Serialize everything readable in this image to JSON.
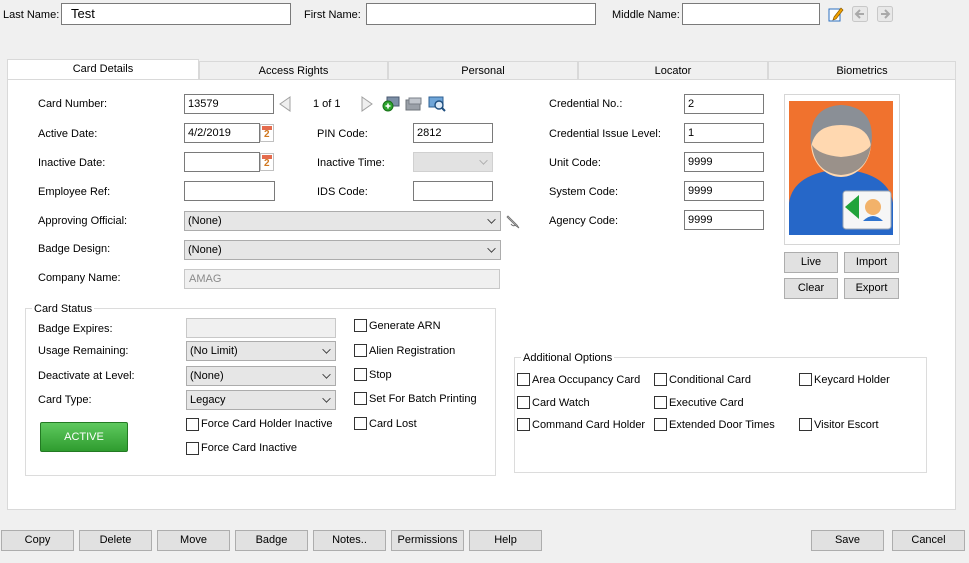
{
  "header": {
    "last_name_label": "Last Name:",
    "last_name_value": "Test",
    "first_name_label": "First Name:",
    "first_name_value": "",
    "middle_name_label": "Middle Name:",
    "middle_name_value": ""
  },
  "tabs": [
    {
      "label": "Card Details"
    },
    {
      "label": "Access Rights"
    },
    {
      "label": "Personal"
    },
    {
      "label": "Locator"
    },
    {
      "label": "Biometrics"
    }
  ],
  "card": {
    "card_number_label": "Card Number:",
    "card_number_value": "13579",
    "pager_text": "1 of 1",
    "active_date_label": "Active Date:",
    "active_date_value": "4/2/2019",
    "inactive_date_label": "Inactive Date:",
    "inactive_date_value": "",
    "employee_ref_label": "Employee Ref:",
    "employee_ref_value": "",
    "approving_official_label": "Approving Official:",
    "approving_official_value": "(None)",
    "badge_design_label": "Badge Design:",
    "badge_design_value": "(None)",
    "company_name_label": "Company Name:",
    "company_name_value": "AMAG",
    "pin_code_label": "PIN Code:",
    "pin_code_value": "2812",
    "inactive_time_label": "Inactive Time:",
    "inactive_time_value": "",
    "ids_code_label": "IDS Code:",
    "ids_code_value": ""
  },
  "credential": {
    "credential_no_label": "Credential No.:",
    "credential_no_value": "2",
    "issue_level_label": "Credential Issue Level:",
    "issue_level_value": "1",
    "unit_code_label": "Unit Code:",
    "unit_code_value": "9999",
    "system_code_label": "System Code:",
    "system_code_value": "9999",
    "agency_code_label": "Agency Code:",
    "agency_code_value": "9999"
  },
  "photo": {
    "live_label": "Live",
    "import_label": "Import",
    "clear_label": "Clear",
    "export_label": "Export"
  },
  "card_status": {
    "title": "Card Status",
    "badge_expires_label": "Badge Expires:",
    "badge_expires_value": "",
    "usage_remaining_label": "Usage Remaining:",
    "usage_remaining_value": "(No Limit)",
    "deactivate_label": "Deactivate at Level:",
    "deactivate_value": "(None)",
    "card_type_label": "Card Type:",
    "card_type_value": "Legacy",
    "active_button": "ACTIVE",
    "force_holder_inactive": "Force Card Holder Inactive",
    "force_card_inactive": "Force Card Inactive",
    "generate_arn": "Generate ARN",
    "alien_registration": "Alien Registration",
    "stop": "Stop",
    "batch_printing": "Set For Batch Printing",
    "card_lost": "Card Lost"
  },
  "additional_options": {
    "title": "Additional Options",
    "area_occupancy": "Area Occupancy Card",
    "conditional": "Conditional Card",
    "keycard_holder": "Keycard Holder",
    "card_watch": "Card Watch",
    "executive": "Executive Card",
    "command_holder": "Command Card Holder",
    "extended_door": "Extended Door Times",
    "visitor_escort": "Visitor Escort"
  },
  "footer": {
    "copy": "Copy",
    "delete": "Delete",
    "move": "Move",
    "badge": "Badge",
    "notes": "Notes..",
    "permissions": "Permissions",
    "help": "Help",
    "save": "Save",
    "cancel": "Cancel"
  },
  "colors": {
    "active_green": "#3fae3f",
    "panel_bg": "#ffffff",
    "window_bg": "#f0f0f0"
  }
}
